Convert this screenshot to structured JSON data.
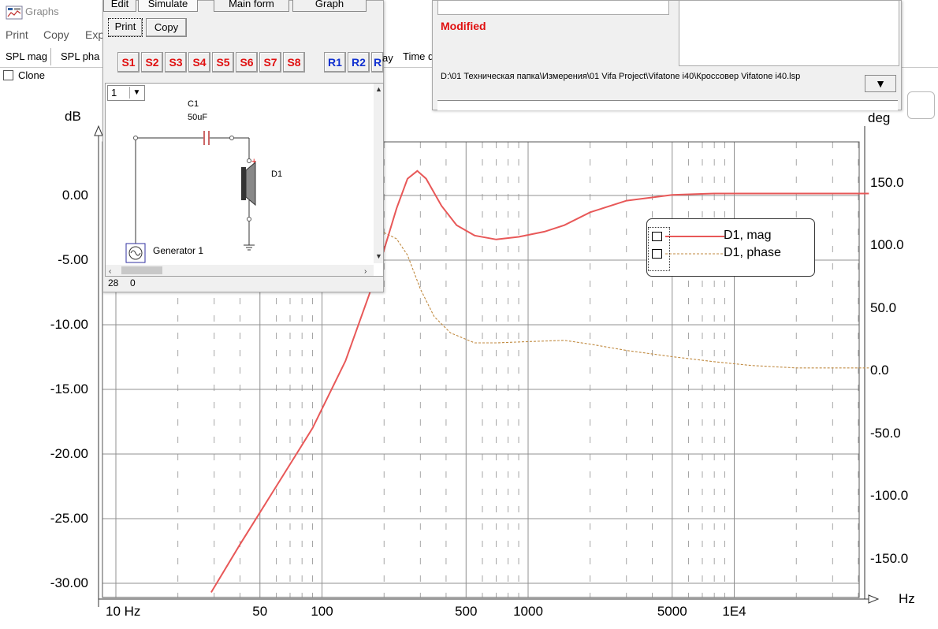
{
  "window": {
    "title": "Graphs"
  },
  "menu": [
    {
      "label": "Print",
      "x": 7
    },
    {
      "label": "Copy",
      "x": 55
    },
    {
      "label": "Exp",
      "x": 108
    }
  ],
  "tabs": [
    {
      "label": "SPL mag"
    },
    {
      "label": "SPL pha"
    },
    {
      "label": "Time d"
    }
  ],
  "clone_label": "Clone",
  "graph": {
    "left_unit": "dB",
    "right_unit": "deg",
    "x_unit": "Hz",
    "left_ticks": [
      "0.00",
      "-5.00",
      "-10.00",
      "-15.00",
      "-20.00",
      "-25.00",
      "-30.00"
    ],
    "right_ticks": [
      "150.0",
      "100.0",
      "50.0",
      "0.0",
      "-50.0",
      "-100.0",
      "-150.0"
    ],
    "x_ticks": [
      "10 Hz",
      "50",
      "100",
      "500",
      "1000",
      "5000",
      "1E4"
    ]
  },
  "legend": {
    "entries": [
      {
        "name": "D1, mag",
        "color": "#e85858",
        "style": "solid"
      },
      {
        "name": "D1, phase",
        "color": "#c08a40",
        "style": "dashed"
      }
    ]
  },
  "crossover": {
    "tabs": [
      "Edit",
      "Simulate",
      "Main form",
      "Graph"
    ],
    "print_label": "Print",
    "copy_label": "Copy",
    "s_buttons": [
      "S1",
      "S2",
      "S3",
      "S4",
      "S5",
      "S6",
      "S7",
      "S8"
    ],
    "r_buttons": [
      "R1",
      "R2",
      "R"
    ],
    "r_overflow": "ay",
    "selector_value": "1",
    "component": {
      "name": "C1",
      "value": "50uF"
    },
    "driver_label": "D1",
    "generator_label": "Generator 1",
    "status": {
      "left": "28",
      "right": "0"
    }
  },
  "info": {
    "modified": "Modified",
    "path": "D:\\01 Техническая папка\\Измерения\\01 Vifa Project\\Vifatone i40\\Кроссовер Vifatone i40.lsp"
  },
  "colors": {
    "mag": "#e85858",
    "phase": "#c08a40",
    "grid": "#909090",
    "accent_red": "#e01010",
    "accent_blue": "#1030d0"
  }
}
